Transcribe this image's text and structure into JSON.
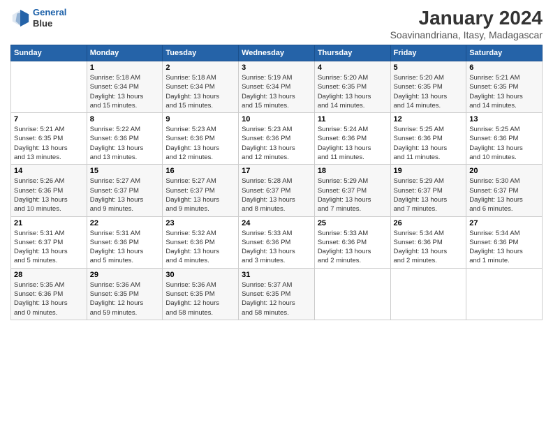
{
  "logo": {
    "line1": "General",
    "line2": "Blue"
  },
  "title": "January 2024",
  "subtitle": "Soavinandriana, Itasy, Madagascar",
  "weekdays": [
    "Sunday",
    "Monday",
    "Tuesday",
    "Wednesday",
    "Thursday",
    "Friday",
    "Saturday"
  ],
  "weeks": [
    [
      {
        "day": "",
        "info": ""
      },
      {
        "day": "1",
        "info": "Sunrise: 5:18 AM\nSunset: 6:34 PM\nDaylight: 13 hours\nand 15 minutes."
      },
      {
        "day": "2",
        "info": "Sunrise: 5:18 AM\nSunset: 6:34 PM\nDaylight: 13 hours\nand 15 minutes."
      },
      {
        "day": "3",
        "info": "Sunrise: 5:19 AM\nSunset: 6:34 PM\nDaylight: 13 hours\nand 15 minutes."
      },
      {
        "day": "4",
        "info": "Sunrise: 5:20 AM\nSunset: 6:35 PM\nDaylight: 13 hours\nand 14 minutes."
      },
      {
        "day": "5",
        "info": "Sunrise: 5:20 AM\nSunset: 6:35 PM\nDaylight: 13 hours\nand 14 minutes."
      },
      {
        "day": "6",
        "info": "Sunrise: 5:21 AM\nSunset: 6:35 PM\nDaylight: 13 hours\nand 14 minutes."
      }
    ],
    [
      {
        "day": "7",
        "info": "Sunrise: 5:21 AM\nSunset: 6:35 PM\nDaylight: 13 hours\nand 13 minutes."
      },
      {
        "day": "8",
        "info": "Sunrise: 5:22 AM\nSunset: 6:36 PM\nDaylight: 13 hours\nand 13 minutes."
      },
      {
        "day": "9",
        "info": "Sunrise: 5:23 AM\nSunset: 6:36 PM\nDaylight: 13 hours\nand 12 minutes."
      },
      {
        "day": "10",
        "info": "Sunrise: 5:23 AM\nSunset: 6:36 PM\nDaylight: 13 hours\nand 12 minutes."
      },
      {
        "day": "11",
        "info": "Sunrise: 5:24 AM\nSunset: 6:36 PM\nDaylight: 13 hours\nand 11 minutes."
      },
      {
        "day": "12",
        "info": "Sunrise: 5:25 AM\nSunset: 6:36 PM\nDaylight: 13 hours\nand 11 minutes."
      },
      {
        "day": "13",
        "info": "Sunrise: 5:25 AM\nSunset: 6:36 PM\nDaylight: 13 hours\nand 10 minutes."
      }
    ],
    [
      {
        "day": "14",
        "info": "Sunrise: 5:26 AM\nSunset: 6:36 PM\nDaylight: 13 hours\nand 10 minutes."
      },
      {
        "day": "15",
        "info": "Sunrise: 5:27 AM\nSunset: 6:37 PM\nDaylight: 13 hours\nand 9 minutes."
      },
      {
        "day": "16",
        "info": "Sunrise: 5:27 AM\nSunset: 6:37 PM\nDaylight: 13 hours\nand 9 minutes."
      },
      {
        "day": "17",
        "info": "Sunrise: 5:28 AM\nSunset: 6:37 PM\nDaylight: 13 hours\nand 8 minutes."
      },
      {
        "day": "18",
        "info": "Sunrise: 5:29 AM\nSunset: 6:37 PM\nDaylight: 13 hours\nand 7 minutes."
      },
      {
        "day": "19",
        "info": "Sunrise: 5:29 AM\nSunset: 6:37 PM\nDaylight: 13 hours\nand 7 minutes."
      },
      {
        "day": "20",
        "info": "Sunrise: 5:30 AM\nSunset: 6:37 PM\nDaylight: 13 hours\nand 6 minutes."
      }
    ],
    [
      {
        "day": "21",
        "info": "Sunrise: 5:31 AM\nSunset: 6:37 PM\nDaylight: 13 hours\nand 5 minutes."
      },
      {
        "day": "22",
        "info": "Sunrise: 5:31 AM\nSunset: 6:36 PM\nDaylight: 13 hours\nand 5 minutes."
      },
      {
        "day": "23",
        "info": "Sunrise: 5:32 AM\nSunset: 6:36 PM\nDaylight: 13 hours\nand 4 minutes."
      },
      {
        "day": "24",
        "info": "Sunrise: 5:33 AM\nSunset: 6:36 PM\nDaylight: 13 hours\nand 3 minutes."
      },
      {
        "day": "25",
        "info": "Sunrise: 5:33 AM\nSunset: 6:36 PM\nDaylight: 13 hours\nand 2 minutes."
      },
      {
        "day": "26",
        "info": "Sunrise: 5:34 AM\nSunset: 6:36 PM\nDaylight: 13 hours\nand 2 minutes."
      },
      {
        "day": "27",
        "info": "Sunrise: 5:34 AM\nSunset: 6:36 PM\nDaylight: 13 hours\nand 1 minute."
      }
    ],
    [
      {
        "day": "28",
        "info": "Sunrise: 5:35 AM\nSunset: 6:36 PM\nDaylight: 13 hours\nand 0 minutes."
      },
      {
        "day": "29",
        "info": "Sunrise: 5:36 AM\nSunset: 6:35 PM\nDaylight: 12 hours\nand 59 minutes."
      },
      {
        "day": "30",
        "info": "Sunrise: 5:36 AM\nSunset: 6:35 PM\nDaylight: 12 hours\nand 58 minutes."
      },
      {
        "day": "31",
        "info": "Sunrise: 5:37 AM\nSunset: 6:35 PM\nDaylight: 12 hours\nand 58 minutes."
      },
      {
        "day": "",
        "info": ""
      },
      {
        "day": "",
        "info": ""
      },
      {
        "day": "",
        "info": ""
      }
    ]
  ]
}
